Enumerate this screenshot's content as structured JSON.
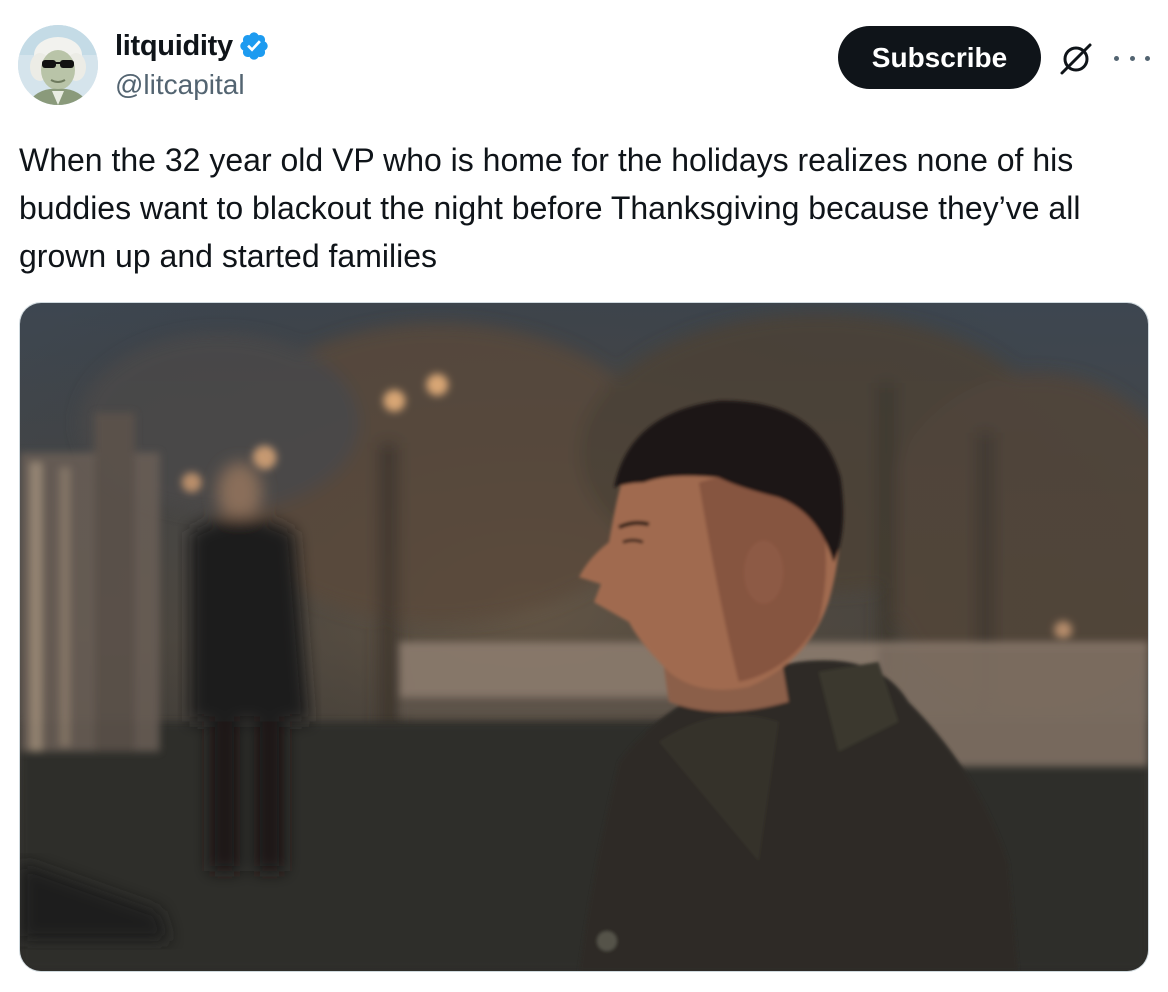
{
  "author": {
    "display_name": "litquidity",
    "handle": "@litcapital",
    "verified_icon": "verified-badge-icon",
    "verified_color": "#1d9bf0"
  },
  "actions": {
    "subscribe_label": "Subscribe",
    "grok_icon": "grok-slash-icon",
    "more_icon": "more-horizontal-icon"
  },
  "tweet": {
    "text": "When the 32 year old VP who is home for the holidays realizes none of his buddies want to blackout the night before Thanksgiving because they’ve all grown up and started families"
  },
  "media": {
    "type": "photo"
  }
}
